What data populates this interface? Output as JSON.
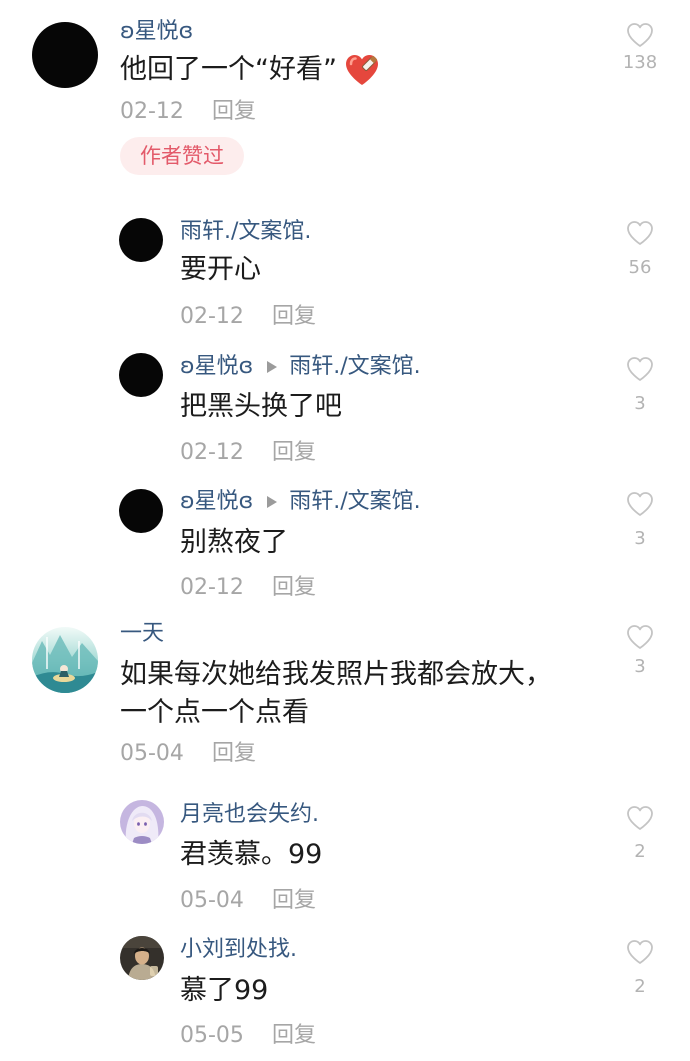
{
  "theme": {
    "username_color": "#37587f",
    "text_color": "#1c1c1c",
    "meta_color": "#a6a6a6",
    "badge_bg": "#fdeded",
    "badge_text": "#e35a6a",
    "count_color": "#b3b3b3",
    "arrow_color": "#9b9b9b"
  },
  "icons": {
    "like": "heart-outline-icon",
    "reply_arrow": "triangle-right-icon",
    "content_emoji": "heart-emoji"
  },
  "comments": [
    {
      "username": "ʚ星悦ɞ",
      "content": "他回了一个“好看”",
      "date": "02-12",
      "reply_label": "回复",
      "badge": "作者赞过",
      "likes": "138",
      "replies": [
        {
          "username": "雨轩./文案馆.",
          "content": "要开心",
          "date": "02-12",
          "reply_label": "回复",
          "likes": "56"
        },
        {
          "username": "ʚ星悦ɞ",
          "reply_to": "雨轩./文案馆.",
          "content": "把黑头换了吧",
          "date": "02-12",
          "reply_label": "回复",
          "likes": "3"
        },
        {
          "username": "ʚ星悦ɞ",
          "reply_to": "雨轩./文案馆.",
          "content": "别熬夜了",
          "date": "02-12",
          "reply_label": "回复",
          "likes": "3"
        }
      ]
    },
    {
      "username": "一天",
      "content": "如果每次她给我发照片我都会放大，一个点一个点看",
      "date": "05-04",
      "reply_label": "回复",
      "likes": "3",
      "replies": [
        {
          "username": "月亮也会失约.",
          "content": "君羡慕。99",
          "date": "05-04",
          "reply_label": "回复",
          "likes": "2"
        },
        {
          "username": "小刘到处找.",
          "content": "慕了99",
          "date": "05-05",
          "reply_label": "回复",
          "likes": "2"
        }
      ]
    }
  ]
}
